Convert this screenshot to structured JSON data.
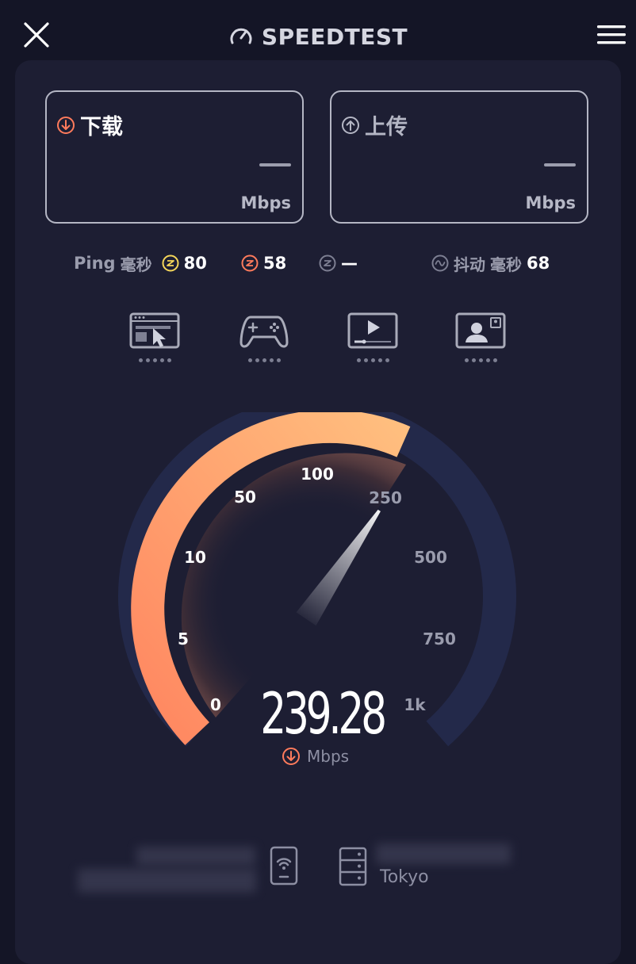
{
  "app": {
    "title": "SPEEDTEST"
  },
  "download": {
    "label": "下载",
    "value": "—",
    "unit": "Mbps"
  },
  "upload": {
    "label": "上传",
    "value": "—",
    "unit": "Mbps"
  },
  "ping": {
    "label": "Ping",
    "unit_label": "毫秒",
    "idle": "80",
    "download": "58",
    "upload": "—",
    "jitter_label": "抖动",
    "jitter_unit": "毫秒",
    "jitter": "68"
  },
  "activities": [
    {
      "name": "web-browsing-icon"
    },
    {
      "name": "gaming-icon"
    },
    {
      "name": "video-streaming-icon"
    },
    {
      "name": "video-call-icon"
    }
  ],
  "gauge": {
    "ticks": [
      "0",
      "5",
      "10",
      "50",
      "100",
      "250",
      "500",
      "750",
      "1k"
    ],
    "current_speed": "239.28",
    "unit": "Mbps"
  },
  "server": {
    "city": "Tokyo"
  },
  "colors": {
    "accent": "#ff8f5e",
    "accent_light": "#ffb478",
    "track": "#23294a",
    "background": "#141526"
  }
}
